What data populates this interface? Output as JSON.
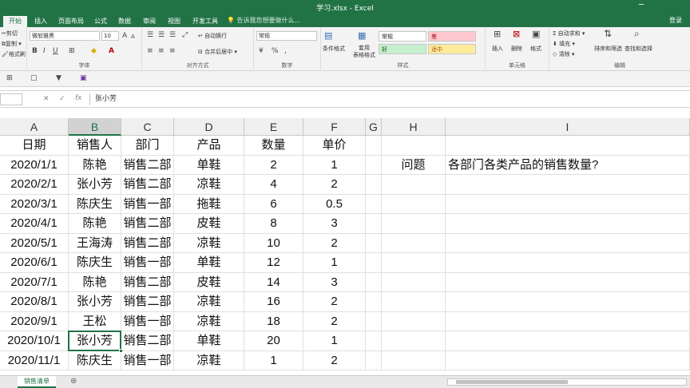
{
  "window": {
    "title": "学习.xlsx - Excel",
    "minimize": "─",
    "login": "登录"
  },
  "tabs": [
    "开始",
    "插入",
    "页面布局",
    "公式",
    "数据",
    "审阅",
    "视图",
    "开发工具"
  ],
  "tell_me": "告诉我您想要做什么...",
  "ribbon": {
    "clipboard": {
      "cut": "剪切",
      "copy": "复制 ▾",
      "format_painter": "格式刷",
      "label": "剪贴板"
    },
    "font": {
      "name": "微软雅黑",
      "size": "10",
      "label": "字体"
    },
    "alignment": {
      "wrap": "自动换行",
      "merge": "合并后居中 ▾",
      "label": "对齐方式"
    },
    "number": {
      "format": "常规",
      "label": "数字"
    },
    "styles": {
      "conditional": "条件格式",
      "table": "套用\n表格格式",
      "normal": "常规",
      "bad": "差",
      "good": "好",
      "neutral": "适中",
      "label": "样式"
    },
    "cells": {
      "insert": "插入",
      "delete": "删除",
      "format": "格式",
      "label": "单元格"
    },
    "editing": {
      "autosum": "自动求和 ▾",
      "fill": "填充 ▾",
      "clear": "清除 ▾",
      "sort": "排序和筛选",
      "find": "查找和选择",
      "label": "编辑"
    }
  },
  "formula_bar": {
    "value": "张小芳",
    "fx": "fx"
  },
  "columns": [
    {
      "label": "A"
    },
    {
      "label": "B"
    },
    {
      "label": "C"
    },
    {
      "label": "D"
    },
    {
      "label": "E"
    },
    {
      "label": "F"
    },
    {
      "label": "G"
    },
    {
      "label": "H"
    },
    {
      "label": "I"
    }
  ],
  "rows": [
    [
      "日期",
      "销售人",
      "部门",
      "产品",
      "数量",
      "单价",
      "",
      "",
      ""
    ],
    [
      "2020/1/1",
      "陈艳",
      "销售二部",
      "单鞋",
      "2",
      "1",
      "",
      "问题",
      "各部门各类产品的销售数量?"
    ],
    [
      "2020/2/1",
      "张小芳",
      "销售二部",
      "凉鞋",
      "4",
      "2",
      "",
      "",
      ""
    ],
    [
      "2020/3/1",
      "陈庆生",
      "销售一部",
      "拖鞋",
      "6",
      "0.5",
      "",
      "",
      ""
    ],
    [
      "2020/4/1",
      "陈艳",
      "销售二部",
      "皮鞋",
      "8",
      "3",
      "",
      "",
      ""
    ],
    [
      "2020/5/1",
      "王海涛",
      "销售二部",
      "凉鞋",
      "10",
      "2",
      "",
      "",
      ""
    ],
    [
      "2020/6/1",
      "陈庆生",
      "销售一部",
      "单鞋",
      "12",
      "1",
      "",
      "",
      ""
    ],
    [
      "2020/7/1",
      "陈艳",
      "销售二部",
      "皮鞋",
      "14",
      "3",
      "",
      "",
      ""
    ],
    [
      "2020/8/1",
      "张小芳",
      "销售二部",
      "凉鞋",
      "16",
      "2",
      "",
      "",
      ""
    ],
    [
      "2020/9/1",
      "王松",
      "销售一部",
      "凉鞋",
      "18",
      "2",
      "",
      "",
      ""
    ],
    [
      "2020/10/1",
      "张小芳",
      "销售二部",
      "单鞋",
      "20",
      "1",
      "",
      "",
      ""
    ],
    [
      "2020/11/1",
      "陈庆生",
      "销售一部",
      "凉鞋",
      "1",
      "2",
      "",
      "",
      ""
    ]
  ],
  "selected_cell": "B11",
  "sheet_tab": "销售清单",
  "add_sheet": "⊕"
}
